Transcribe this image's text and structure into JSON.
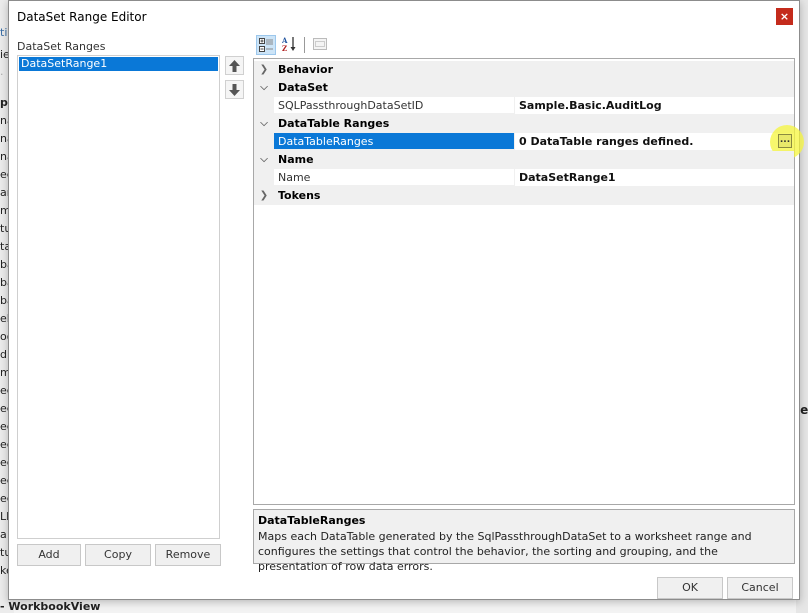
{
  "background_app": {
    "left_fragments": [
      "tic",
      "ie",
      "·",
      "pe",
      "na",
      "na",
      "na",
      "ec",
      "ar",
      "m",
      "tu",
      "ta",
      "ba",
      "ba",
      "ba",
      "el",
      "oo",
      "d",
      "m",
      "ec",
      "ec",
      "ec",
      "ec",
      "ec",
      "ec",
      "ec",
      "LP",
      "a",
      "tu",
      "ke"
    ],
    "bottom_text": "- WorkbookView",
    "right_fragment": "le"
  },
  "dialog": {
    "title": "DataSet Range Editor",
    "close_label": "×",
    "ranges_label": "DataSet Ranges",
    "ranges": [
      {
        "label": "DataSetRange1",
        "selected": true
      }
    ],
    "move_up_icon": "arrow-up-icon",
    "move_down_icon": "arrow-down-icon",
    "buttons": {
      "add": "Add",
      "copy": "Copy",
      "remove": "Remove",
      "ok": "OK",
      "cancel": "Cancel"
    },
    "toolbar": {
      "categorized_icon": "categorized-icon",
      "alphabetical_icon": "sort-az-icon",
      "property_pages_icon": "property-pages-icon"
    },
    "property_grid": {
      "categories": [
        {
          "label": "Behavior",
          "expanded": false,
          "properties": []
        },
        {
          "label": "DataSet",
          "expanded": true,
          "properties": [
            {
              "name": "SQLPassthroughDataSetID",
              "value": "Sample.Basic.AuditLog",
              "selected": false
            }
          ]
        },
        {
          "label": "DataTable Ranges",
          "expanded": true,
          "properties": [
            {
              "name": "DataTableRanges",
              "value": "0 DataTable ranges defined.",
              "selected": true,
              "has_ellipsis": true
            }
          ]
        },
        {
          "label": "Name",
          "expanded": true,
          "properties": [
            {
              "name": "Name",
              "value": "DataSetRange1",
              "selected": false
            }
          ]
        },
        {
          "label": "Tokens",
          "expanded": false,
          "properties": []
        }
      ],
      "ellipsis_label": "..."
    },
    "description": {
      "title": "DataTableRanges",
      "text": "Maps each DataTable generated by the SqlPassthroughDataSet to a worksheet range and configures the settings that control the behavior, the sorting and grouping, and the presentation of row data errors."
    }
  }
}
